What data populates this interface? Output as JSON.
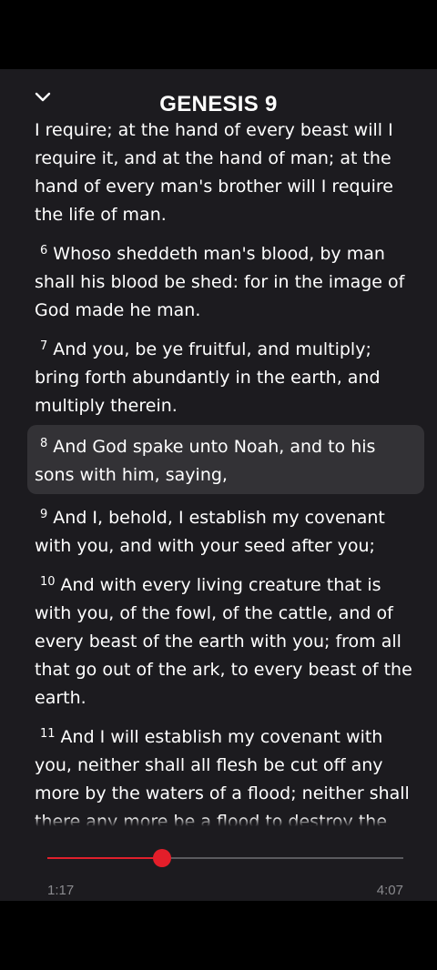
{
  "header": {
    "title": "GENESIS 9",
    "collapse_icon": "chevron-down-icon"
  },
  "verses": [
    {
      "number": "",
      "text": "I require; at the hand of every beast will I require it, and at the hand of man; at the hand of every man's brother will I require the life of man.",
      "highlighted": false
    },
    {
      "number": "6",
      "text": "Whoso sheddeth man's blood, by man shall his blood be shed: for in the image of God made he man.",
      "highlighted": false
    },
    {
      "number": "7",
      "text": "And you, be ye fruitful, and multiply; bring forth abundantly in the earth, and multiply therein.",
      "highlighted": false
    },
    {
      "number": "8",
      "text": "And God spake unto Noah, and to his sons with him, saying,",
      "highlighted": true
    },
    {
      "number": "9",
      "text": "And I, behold, I establish my covenant with you, and with your seed after you;",
      "highlighted": false
    },
    {
      "number": "10",
      "text": "And with every living creature that is with you, of the fowl, of the cattle, and of every beast of the earth with you; from all that go out of the ark, to every beast of the earth.",
      "highlighted": false
    },
    {
      "number": "11",
      "text": "And I will establish my covenant with you, neither shall all flesh be cut off any more by the waters of a flood; neither shall there any more be a flood to destroy the earth.",
      "highlighted": false
    }
  ],
  "player": {
    "elapsed": "1:17",
    "total": "4:07",
    "progress": 0.321,
    "accent_color": "#e41e2a"
  },
  "colors": {
    "panel_background": "#1c1b1f",
    "highlight_background": "#333236",
    "text": "#ffffff",
    "muted_text": "#8a8a8e"
  }
}
